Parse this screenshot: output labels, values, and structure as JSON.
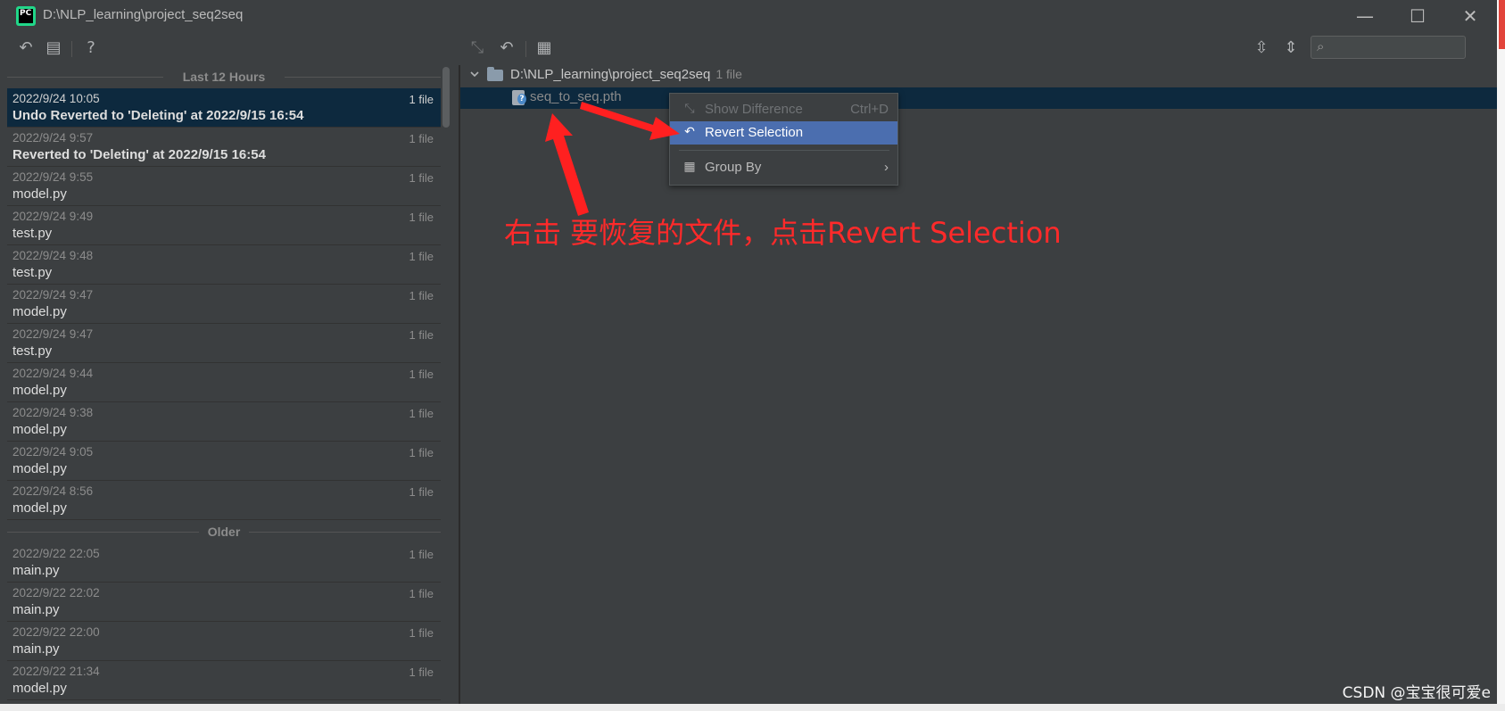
{
  "window": {
    "title": "D:\\NLP_learning\\project_seq2seq",
    "app_icon_text": "PC",
    "controls": {
      "minimize": "—",
      "maximize": "☐",
      "close": "✕"
    }
  },
  "toolbar": {
    "left_icons": [
      "undo-icon",
      "file-icon",
      "help-icon"
    ],
    "center_icons": [
      "show-diff-icon",
      "revert-icon",
      "group-by-icon"
    ],
    "right_icons": [
      "expand-all-icon",
      "collapse-all-icon"
    ],
    "search_placeholder": ""
  },
  "history": {
    "section_recent": "Last 12 Hours",
    "section_older": "Older",
    "recent": [
      {
        "time": "2022/9/24 10:05",
        "desc": "Undo Reverted to 'Deleting' at 2022/9/15 16:54",
        "count": "1 file",
        "bold": true,
        "selected": true
      },
      {
        "time": "2022/9/24 9:57",
        "desc": "Reverted to 'Deleting' at 2022/9/15 16:54",
        "count": "1 file",
        "bold": true,
        "selected": false
      },
      {
        "time": "2022/9/24 9:55",
        "desc": "model.py",
        "count": "1 file"
      },
      {
        "time": "2022/9/24 9:49",
        "desc": "test.py",
        "count": "1 file"
      },
      {
        "time": "2022/9/24 9:48",
        "desc": "test.py",
        "count": "1 file"
      },
      {
        "time": "2022/9/24 9:47",
        "desc": "model.py",
        "count": "1 file"
      },
      {
        "time": "2022/9/24 9:47",
        "desc": "test.py",
        "count": "1 file"
      },
      {
        "time": "2022/9/24 9:44",
        "desc": "model.py",
        "count": "1 file"
      },
      {
        "time": "2022/9/24 9:38",
        "desc": "model.py",
        "count": "1 file"
      },
      {
        "time": "2022/9/24 9:05",
        "desc": "model.py",
        "count": "1 file"
      },
      {
        "time": "2022/9/24 8:56",
        "desc": "model.py",
        "count": "1 file"
      }
    ],
    "older": [
      {
        "time": "2022/9/22 22:05",
        "desc": "main.py",
        "count": "1 file"
      },
      {
        "time": "2022/9/22 22:02",
        "desc": "main.py",
        "count": "1 file"
      },
      {
        "time": "2022/9/22 22:00",
        "desc": "main.py",
        "count": "1 file"
      },
      {
        "time": "2022/9/22 21:34",
        "desc": "model.py",
        "count": "1 file"
      }
    ]
  },
  "tree": {
    "root_path": "D:\\NLP_learning\\project_seq2seq",
    "root_count": "1 file",
    "file_name": "seq_to_seq.pth"
  },
  "context_menu": {
    "items": [
      {
        "label": "Show Difference",
        "shortcut": "Ctrl+D",
        "icon": "show-diff-icon",
        "disabled": true
      },
      {
        "label": "Revert Selection",
        "shortcut": "",
        "icon": "revert-icon",
        "highlighted": true
      },
      {
        "label": "Group By",
        "shortcut": "›",
        "icon": "group-by-icon"
      }
    ]
  },
  "annotation": {
    "text": "右击 要恢复的文件，点击Revert Selection",
    "color": "#ff2a2a"
  },
  "watermark": "CSDN @宝宝很可爱e",
  "colors": {
    "background": "#3c3f41",
    "selection": "#0d293e",
    "menu_highlight": "#4b6eaf"
  }
}
